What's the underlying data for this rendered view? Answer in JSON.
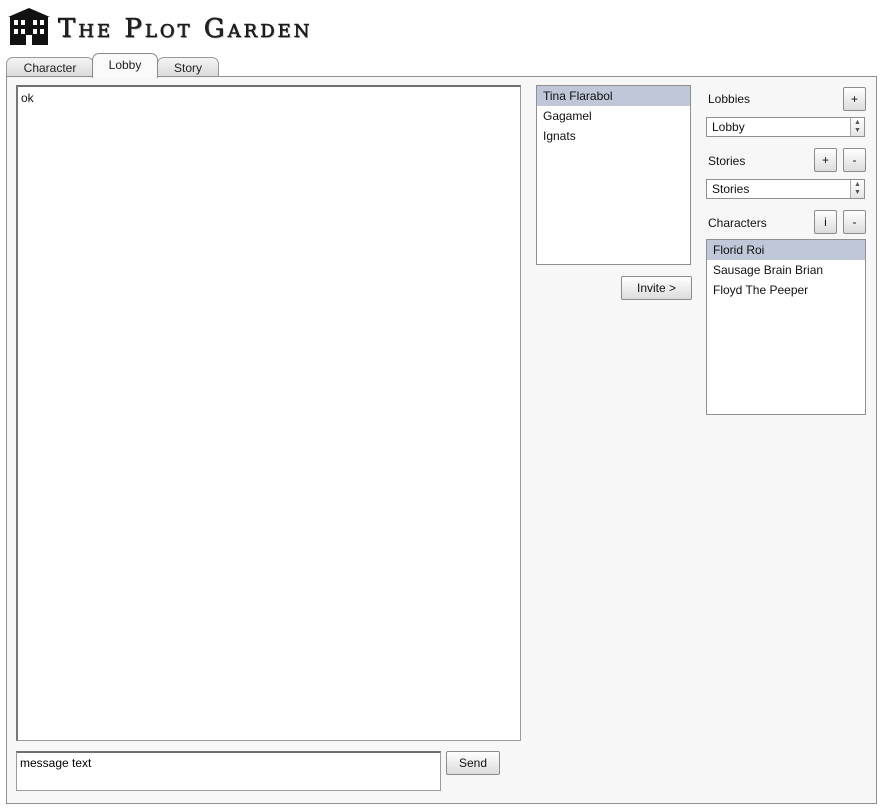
{
  "app": {
    "title": "The Plot Garden"
  },
  "tabs": [
    {
      "label": "Character",
      "active": false
    },
    {
      "label": "Lobby",
      "active": true
    },
    {
      "label": "Story",
      "active": false
    }
  ],
  "chat": {
    "messages": [
      "ok"
    ],
    "input_placeholder": "message text",
    "send_label": "Send"
  },
  "players": {
    "items": [
      "Tina Flarabol",
      "Gagamel",
      "Ignats"
    ],
    "selected_index": 0,
    "invite_label": "Invite >"
  },
  "lobbies": {
    "label": "Lobbies",
    "add_label": "+",
    "selected": "Lobby"
  },
  "stories": {
    "label": "Stories",
    "add_label": "+",
    "remove_label": "-",
    "selected": "Stories"
  },
  "characters": {
    "label": "Characters",
    "info_label": "i",
    "remove_label": "-",
    "items": [
      "Florid Roi",
      "Sausage Brain Brian",
      "Floyd The Peeper"
    ],
    "selected_index": 0
  },
  "colors": {
    "selection": "#bfc7d8",
    "panel": "#f7f7f7"
  }
}
